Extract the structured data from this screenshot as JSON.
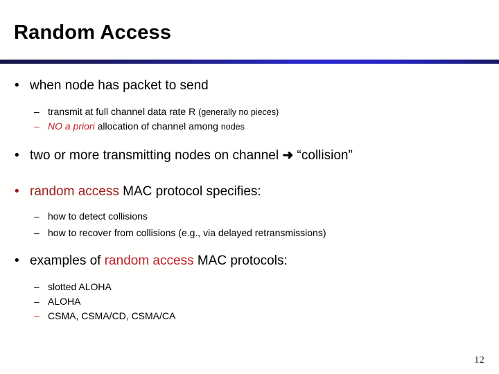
{
  "slide": {
    "title": "Random Access",
    "page_number": "12",
    "accent_rule_color_left": "#141446",
    "accent_rule_color_mid": "#2727cf",
    "accent_rule_color_right": "#191963",
    "bullet_marker": "•",
    "dash_marker": "–",
    "arrow_glyph": "➜",
    "colors": {
      "text": "#000000",
      "red": "#bf2026",
      "dark_red": "#9c1b18",
      "background": "#fffffd"
    }
  },
  "bullets": [
    {
      "marker_color": "#000000",
      "text": "when node has packet to send",
      "sub": [
        {
          "marker_color": "#000000",
          "parts": [
            {
              "text": "transmit at full channel data rate R ",
              "style": "plain"
            },
            {
              "text": "(generally no pieces)",
              "style": "small"
            }
          ]
        },
        {
          "marker_color": "#bf2026",
          "parts": [
            {
              "text": "NO a priori",
              "style": "red-italic"
            },
            {
              "text": " allocation of channel among ",
              "style": "plain"
            },
            {
              "text": "nodes",
              "style": "small"
            }
          ]
        }
      ]
    },
    {
      "marker_color": "#000000",
      "parts": [
        {
          "text": "two or more transmitting nodes on channel ",
          "style": "plain"
        },
        {
          "text": "➜",
          "style": "arrow"
        },
        {
          "text": " “collision”",
          "style": "plain"
        }
      ],
      "sub": []
    },
    {
      "marker_color": "#9c1b18",
      "parts": [
        {
          "text": "random access",
          "style": "dark-red"
        },
        {
          "text": " MAC protocol specifies:",
          "style": "plain"
        }
      ],
      "sub": [
        {
          "marker_color": "#000000",
          "parts": [
            {
              "text": "how to detect collisions",
              "style": "plain"
            }
          ]
        },
        {
          "marker_color": "#000000",
          "parts": [
            {
              "text": "how to recover from collisions (e.g., via delayed retransmissions)",
              "style": "plain"
            }
          ]
        }
      ]
    },
    {
      "marker_color": "#000000",
      "parts": [
        {
          "text": "examples of ",
          "style": "plain"
        },
        {
          "text": "random access",
          "style": "red"
        },
        {
          "text": " MAC protocols:",
          "style": "plain"
        }
      ],
      "sub": [
        {
          "marker_color": "#000000",
          "parts": [
            {
              "text": "slotted ALOHA",
              "style": "plain"
            }
          ]
        },
        {
          "marker_color": "#000000",
          "parts": [
            {
              "text": "ALOHA",
              "style": "plain"
            }
          ]
        },
        {
          "marker_color": "#bf2026",
          "parts": [
            {
              "text": "CSMA, CSMA/CD, CSMA/CA",
              "style": "red"
            }
          ]
        }
      ]
    }
  ]
}
